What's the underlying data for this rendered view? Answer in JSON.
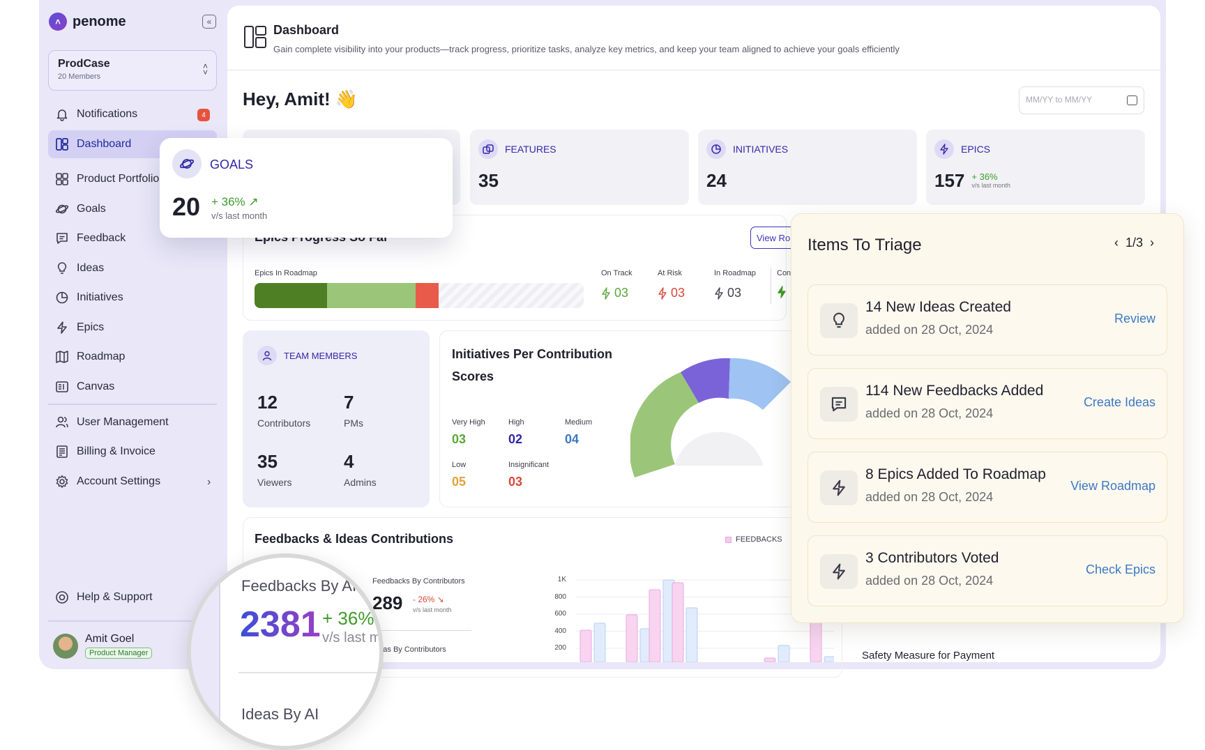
{
  "app": {
    "brand": "penome"
  },
  "workspace": {
    "name": "ProdCase",
    "members": "20 Members"
  },
  "sidebar": {
    "items": [
      {
        "label": "Notifications",
        "icon": "bell-icon",
        "badge": "4"
      },
      {
        "label": "Dashboard",
        "icon": "dashboard-icon",
        "active": true
      },
      {
        "label": "Product Portfolio",
        "icon": "grid-icon"
      },
      {
        "label": "Goals",
        "icon": "planet-icon"
      },
      {
        "label": "Feedback",
        "icon": "chat-icon"
      },
      {
        "label": "Ideas",
        "icon": "bulb-icon"
      },
      {
        "label": "Initiatives",
        "icon": "pie-icon"
      },
      {
        "label": "Epics",
        "icon": "bolt-icon"
      },
      {
        "label": "Roadmap",
        "icon": "map-icon"
      },
      {
        "label": "Canvas",
        "icon": "canvas-icon"
      }
    ],
    "admin_items": [
      {
        "label": "User Management",
        "icon": "users-icon"
      },
      {
        "label": "Billing & Invoice",
        "icon": "invoice-icon"
      },
      {
        "label": "Account Settings",
        "icon": "gear-icon"
      }
    ],
    "help": "Help & Support"
  },
  "user": {
    "name": "Amit Goel",
    "role": "Product Manager"
  },
  "header": {
    "title": "Dashboard",
    "subtitle": "Gain complete visibility into your products—track progress, prioritize tasks, analyze key metrics, and keep your team aligned to achieve your goals efficiently"
  },
  "greeting": "Hey, Amit! 👋",
  "date_range": {
    "placeholder": "MM/YY to MM/YY"
  },
  "stats": {
    "features": {
      "label": "FEATURES",
      "value": "35"
    },
    "initiatives": {
      "label": "INITIATIVES",
      "value": "24"
    },
    "epics": {
      "label": "EPICS",
      "value": "157",
      "delta": "+ 36%",
      "sub": "v/s last month"
    }
  },
  "goals_popup": {
    "label": "GOALS",
    "value": "20",
    "delta": "+ 36%",
    "sub": "v/s last month"
  },
  "epics_progress": {
    "title": "Epics Progress So Far",
    "button": "View Ro",
    "bar_label": "Epics In Roadmap",
    "segments": [
      {
        "share": 0.22,
        "color": "#4e7f25"
      },
      {
        "share": 0.27,
        "color": "#9bc679"
      },
      {
        "share": 0.07,
        "color": "#e85a4a"
      }
    ],
    "legend": [
      {
        "label": "On Track",
        "value": "03",
        "color": "#5aa83a"
      },
      {
        "label": "At Risk",
        "value": "03",
        "color": "#d8483a"
      },
      {
        "label": "In Roadmap",
        "value": "03",
        "color": "#44444e"
      },
      {
        "label": "Con",
        "value": "",
        "color": "#3f9a2a"
      }
    ]
  },
  "team": {
    "label": "TEAM MEMBERS",
    "stats": [
      {
        "value": "12",
        "label": "Contributors"
      },
      {
        "value": "7",
        "label": "PMs"
      },
      {
        "value": "35",
        "label": "Viewers"
      },
      {
        "value": "4",
        "label": "Admins"
      }
    ]
  },
  "contribution": {
    "title": "Initiatives Per Contribution Scores",
    "scores": [
      {
        "label": "Very High",
        "value": "03",
        "color": "#5aa83a"
      },
      {
        "label": "High",
        "value": "02",
        "color": "#2f28a4"
      },
      {
        "label": "Medium",
        "value": "04",
        "color": "#3c78c4"
      },
      {
        "label": "Low",
        "value": "05",
        "color": "#e0a23a"
      },
      {
        "label": "Insignificant",
        "value": "03",
        "color": "#d8483a"
      }
    ]
  },
  "feedbacks": {
    "title": "Feedbacks & Ideas Contributions",
    "legend": "FEEDBACKS",
    "by_contributors_label": "Feedbacks By Contributors",
    "by_contributors_value": "289",
    "by_contributors_delta": "- 26% ↘",
    "by_contributors_sub": "v/s last month",
    "ideas_by_contributors": "Ideas By Contributors",
    "yticks": [
      "1K",
      "800",
      "600",
      "400",
      "200"
    ],
    "safety": "Safety Measure for Payment"
  },
  "magnifier": {
    "title": "Feedbacks By AI",
    "value": "2381",
    "delta": "+ 36%",
    "sub": "v/s last month",
    "ideas": "Ideas By AI"
  },
  "triage": {
    "title": "Items To Triage",
    "pager": "1/3",
    "items": [
      {
        "title": "14 New Ideas Created",
        "date": "added on 28 Oct, 2024",
        "action": "Review",
        "icon": "bulb-icon"
      },
      {
        "title": "114 New Feedbacks Added",
        "date": "added on 28 Oct, 2024",
        "action": "Create Ideas",
        "icon": "chat-icon"
      },
      {
        "title": "8 Epics Added To Roadmap",
        "date": "added on 28 Oct, 2024",
        "action": "View Roadmap",
        "icon": "bolt-icon"
      },
      {
        "title": "3 Contributors Voted",
        "date": "added on 28 Oct, 2024",
        "action": "Check Epics",
        "icon": "bolt-icon"
      }
    ]
  }
}
